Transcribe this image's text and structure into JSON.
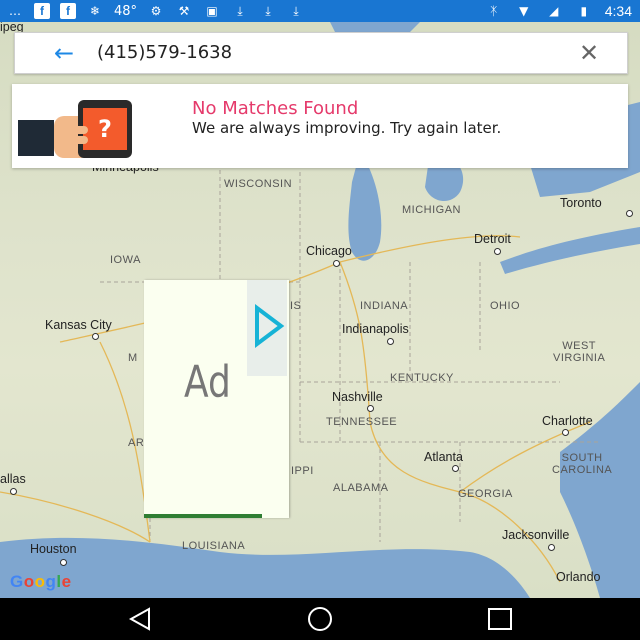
{
  "status_bar": {
    "temperature": "48°",
    "time": "4:34",
    "left_icons": [
      "messaging-icon",
      "facebook-icon",
      "facebook-icon",
      "weather-icon",
      "temperature",
      "cycling-icon",
      "wrench-icon",
      "game-controller-icon",
      "download-icon",
      "download-icon",
      "download-icon"
    ],
    "right_icons": [
      "bluetooth-icon",
      "wifi-icon",
      "no-sim-icon",
      "battery-icon"
    ]
  },
  "search": {
    "value": "(415)579-1638",
    "back_icon": "arrow-left-icon",
    "clear_icon": "close-icon"
  },
  "no_match": {
    "title": "No Matches Found",
    "message": "We are always improving. Try again later."
  },
  "ad": {
    "label": "Ad"
  },
  "map": {
    "labels": {
      "wisconsin": "WISCONSIN",
      "michigan": "MICHIGAN",
      "iowa": "IOWA",
      "indiana": "INDIANA",
      "ohio": "OHIO",
      "kentucky": "KENTUCKY",
      "west_virginia": "WEST\nVIRGINIA",
      "tennessee": "TENNESSEE",
      "alabama": "ALABAMA",
      "georgia": "GEORGIA",
      "south_carolina": "SOUTH\nCAROLINA",
      "louisiana": "LOUISIANA",
      "ippi": "IPPI",
      "is": "IS",
      "ar": "AR",
      "m": "M"
    },
    "cities": {
      "minneapolis": "Minneapolis",
      "winnipeg": "ipeg",
      "toronto": "Toronto",
      "chicago": "Chicago",
      "detroit": "Detroit",
      "kansas_city": "Kansas City",
      "indianapolis": "Indianapolis",
      "nashville": "Nashville",
      "charlotte": "Charlotte",
      "atlanta": "Atlanta",
      "dallas": "allas",
      "houston": "Houston",
      "jacksonville": "Jacksonville",
      "orlando": "Orlando"
    },
    "attribution": "Google"
  },
  "nav": {
    "back": "back-icon",
    "home": "home-icon",
    "recents": "recents-icon"
  },
  "colors": {
    "status_bar": "#1976d2",
    "title_pink": "#e53a6b",
    "accent_blue": "#1e88e5"
  }
}
